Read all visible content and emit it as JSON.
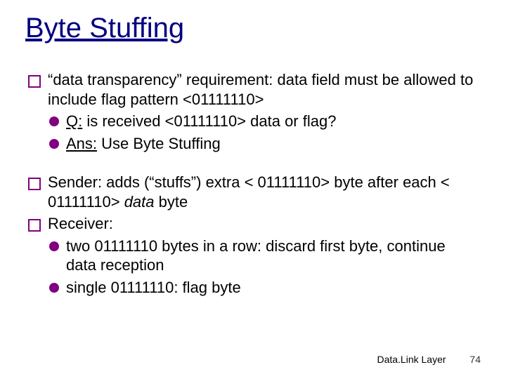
{
  "title": "Byte Stuffing",
  "b1_a": " “data transparency” requirement: data field must be allowed to include flag pattern  <01111110>",
  "b1_q_label": "Q:",
  "b1_q_rest": " is received <01111110> data or flag?",
  "b1_ans_label": "Ans:",
  "b1_ans_rest": " Use Byte Stuffing",
  "b2_a": "Sender: adds (“stuffs”) extra < 01111110> byte after each < 01111110> ",
  "b2_a_em": "data",
  "b2_a_tail": "  byte",
  "b3_a": "Receiver:",
  "b3_sub1": "two 01111110 bytes in a row: discard first byte, continue data reception",
  "b3_sub2": "single 01111110: flag byte",
  "footer_label": "Data.Link Layer",
  "footer_page": "74"
}
